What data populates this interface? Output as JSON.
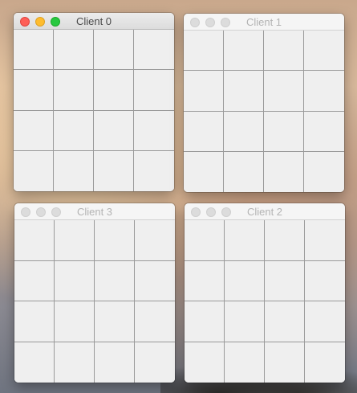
{
  "windows": [
    {
      "id": "w0",
      "title": "Client 0",
      "active": true
    },
    {
      "id": "w1",
      "title": "Client 1",
      "active": false
    },
    {
      "id": "w3",
      "title": "Client 3",
      "active": false
    },
    {
      "id": "w2",
      "title": "Client 2",
      "active": false
    }
  ],
  "grid": {
    "rows": 4,
    "columns": 4
  },
  "colors": {
    "close": "#fe5f57",
    "minimize": "#febc2e",
    "maximize": "#28c840",
    "inactive_light": "#dcdcdc",
    "grid_line": "#9a9a9a",
    "cell": "#efefef"
  }
}
